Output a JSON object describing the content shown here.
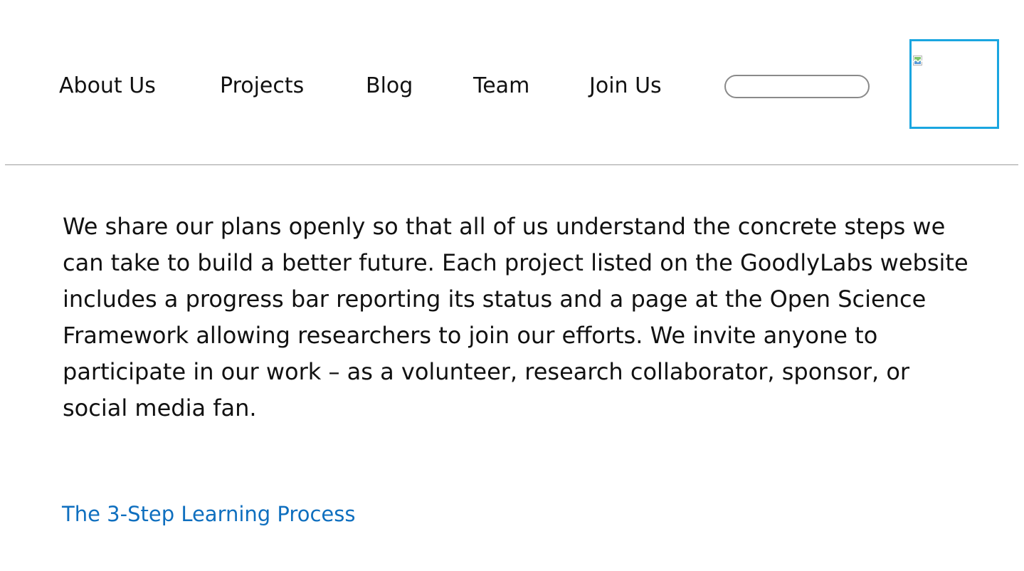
{
  "nav": {
    "items": [
      {
        "label": "About Us"
      },
      {
        "label": "Projects"
      },
      {
        "label": "Blog"
      },
      {
        "label": "Team"
      },
      {
        "label": "Join Us"
      }
    ]
  },
  "search": {
    "value": "",
    "placeholder": ""
  },
  "logo": {
    "icon": "broken-image-icon",
    "border_color": "#1aa6e0"
  },
  "main": {
    "intro_text": "We share our plans openly so that all of us understand the concrete steps we can take to build a better future. Each project listed on the GoodlyLabs website includes a progress bar reporting its status and a page at the Open Science Framework allowing researchers to join our efforts. We invite anyone to participate in our work – as a volunteer, research collaborator, sponsor, or social media fan.",
    "section_link": "The 3-Step Learning Process"
  },
  "colors": {
    "link": "#0f6fbf",
    "text": "#111111",
    "divider": "#9e9e9e"
  }
}
